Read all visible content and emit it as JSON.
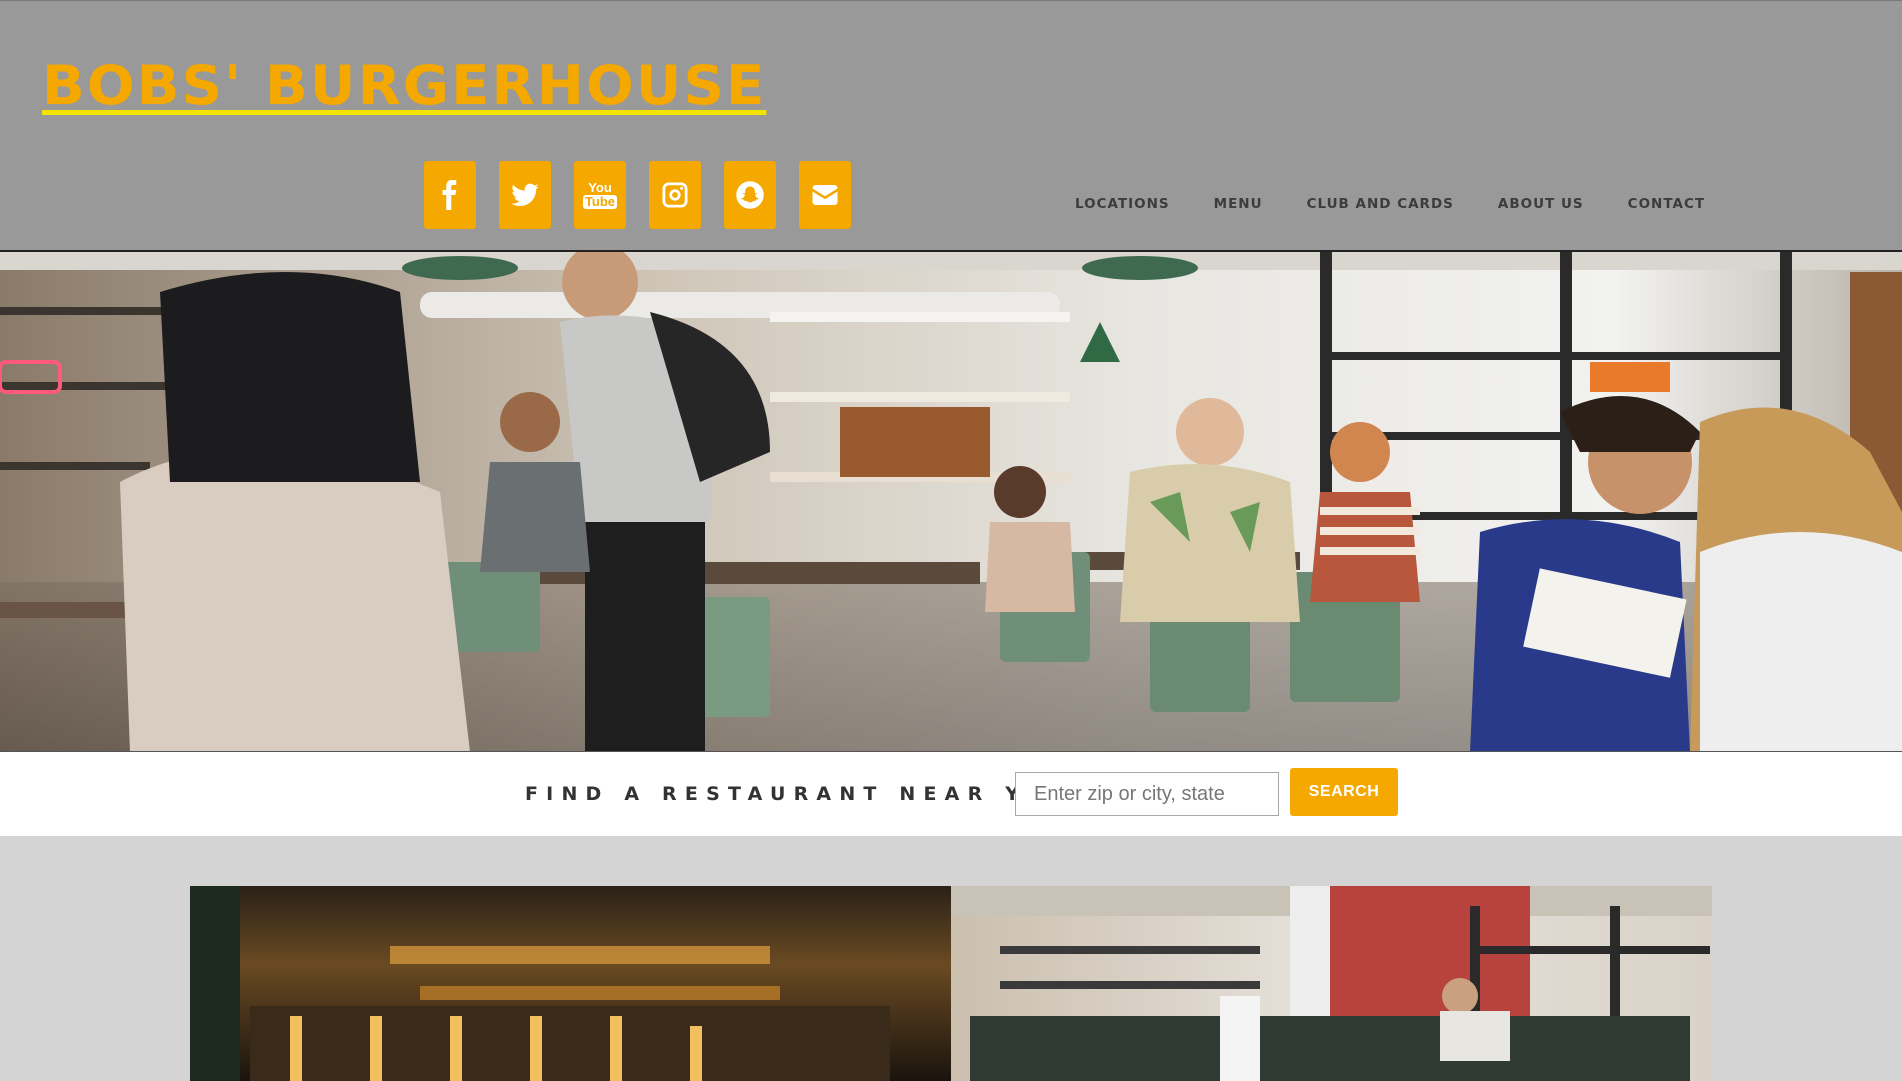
{
  "brand": {
    "name": "Bobs' Burgerhouse",
    "color": "#f4a800",
    "underline_color": "#f2e400"
  },
  "social": [
    {
      "icon": "facebook-icon",
      "label": "Facebook"
    },
    {
      "icon": "twitter-icon",
      "label": "Twitter"
    },
    {
      "icon": "youtube-icon",
      "label": "YouTube",
      "text_top": "You",
      "text_bottom": "Tube"
    },
    {
      "icon": "instagram-icon",
      "label": "Instagram"
    },
    {
      "icon": "snapchat-icon",
      "label": "Snapchat"
    },
    {
      "icon": "email-icon",
      "label": "Email"
    }
  ],
  "nav": {
    "items": [
      {
        "label": "Locations"
      },
      {
        "label": "Menu"
      },
      {
        "label": "Club and Cards"
      },
      {
        "label": "About Us"
      },
      {
        "label": "Contact"
      }
    ]
  },
  "search": {
    "label": "Find a restaurant near you:",
    "placeholder": "Enter zip or city, state",
    "button_label": "Search"
  },
  "colors": {
    "header_bg": "#999999",
    "accent": "#f4a800",
    "page_bg": "#d4d4d4"
  }
}
